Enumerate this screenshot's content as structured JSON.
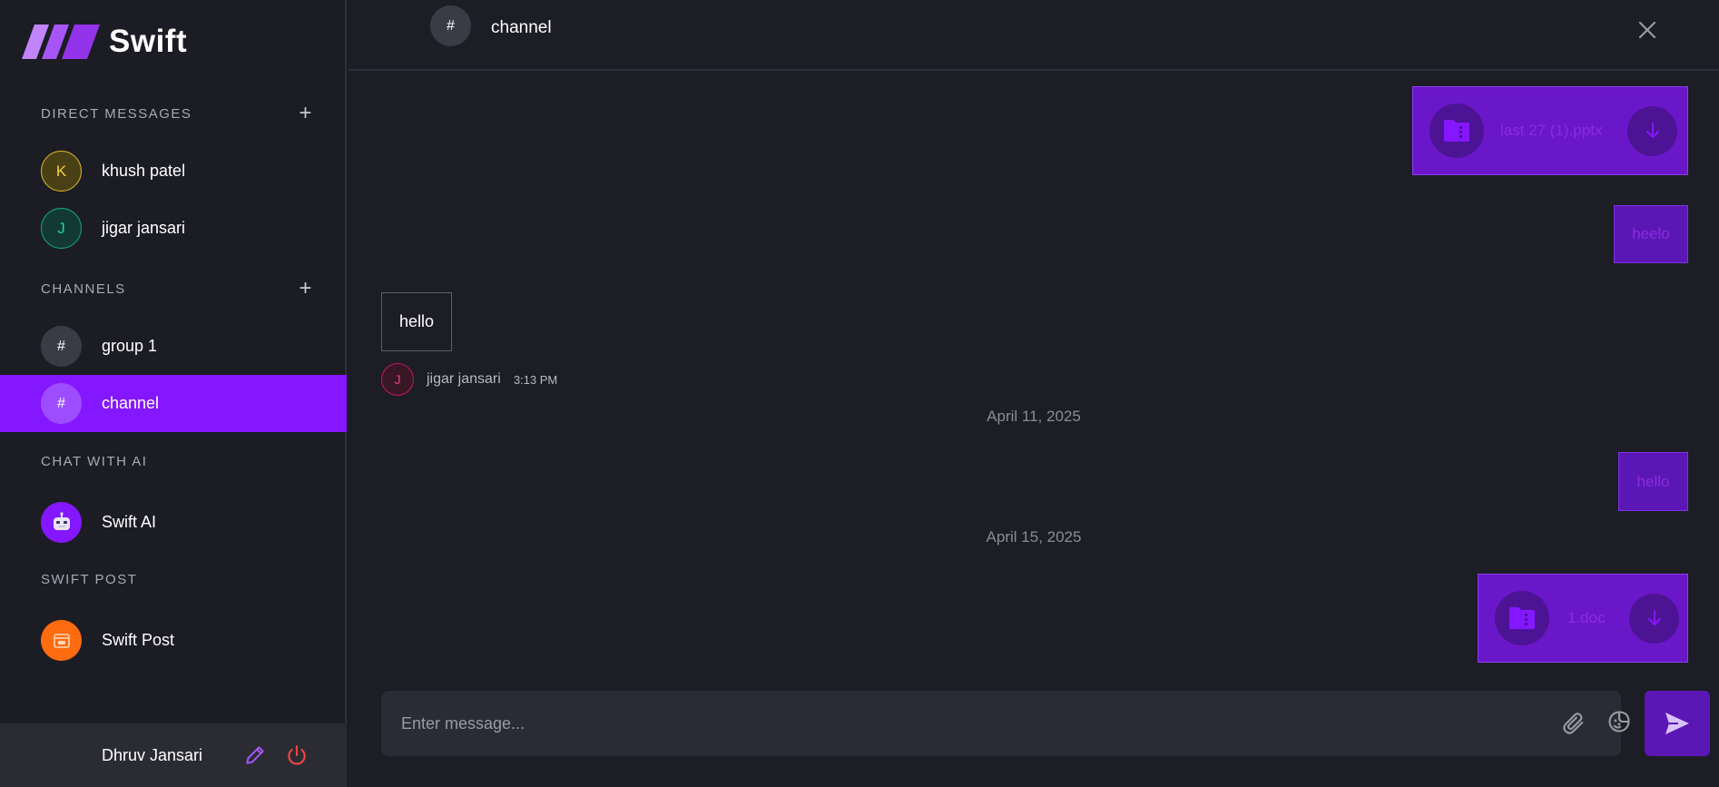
{
  "app": {
    "name": "Swift"
  },
  "sidebar": {
    "direct_messages": {
      "title": "DIRECT MESSAGES",
      "items": [
        {
          "initial": "K",
          "label": "khush patel"
        },
        {
          "initial": "J",
          "label": "jigar jansari"
        }
      ]
    },
    "channels": {
      "title": "CHANNELS",
      "items": [
        {
          "icon": "#",
          "label": "group 1"
        },
        {
          "icon": "#",
          "label": "channel"
        }
      ]
    },
    "ai": {
      "title": "CHAT WITH AI",
      "label": "Swift AI"
    },
    "post": {
      "title": "SWIFT POST",
      "label": "Swift Post"
    },
    "user": {
      "name": "Dhruv Jansari"
    }
  },
  "header": {
    "icon": "#",
    "title": "channel"
  },
  "messages": {
    "file1": {
      "name": "last 27 (1).pptx"
    },
    "msg_heelo": "heelo",
    "msg_hello_in": "hello",
    "sender": {
      "initial": "J",
      "name": "jigar jansari",
      "time": "3:13 PM"
    },
    "date1": "April 11, 2025",
    "msg_hello_out": "hello",
    "date2": "April 15, 2025",
    "file2": {
      "name": "1.doc"
    }
  },
  "composer": {
    "placeholder": "Enter message..."
  },
  "colors": {
    "accent": "#8417ff",
    "background": "#1c1d25",
    "sidebar": "#1b1c24"
  }
}
